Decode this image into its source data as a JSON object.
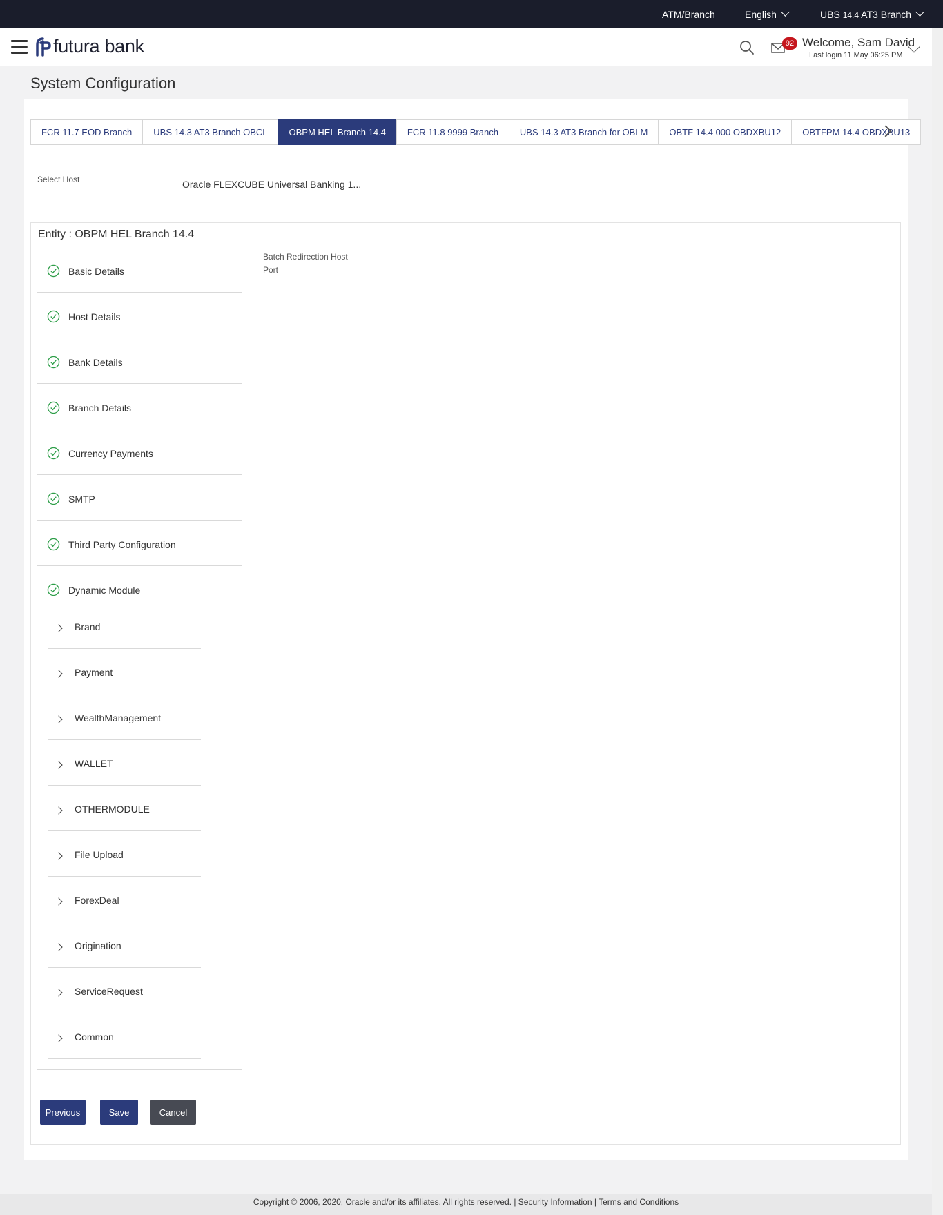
{
  "topbar": {
    "atm_branch": "ATM/Branch",
    "language": "English",
    "entity_prefix": "UBS",
    "entity_version": "14.4",
    "entity_suffix": "AT3 Branch"
  },
  "header": {
    "logo_text": "futura bank",
    "notification_count": "92",
    "welcome": "Welcome, Sam David",
    "last_login": "Last login 11 May 06:25 PM"
  },
  "page": {
    "title": "System Configuration"
  },
  "tabs": [
    {
      "label": "FCR 11.7 EOD Branch"
    },
    {
      "label": "UBS 14.3 AT3 Branch OBCL"
    },
    {
      "label": "OBPM HEL Branch 14.4"
    },
    {
      "label": "FCR 11.8 9999 Branch"
    },
    {
      "label": "UBS 14.3 AT3 Branch for OBLM"
    },
    {
      "label": "OBTF 14.4 000 OBDXBU12"
    },
    {
      "label": "OBTFPM 14.4 OBDXBU13"
    }
  ],
  "active_tab": "OBPM HEL Branch 14.4",
  "select_host": {
    "label": "Select Host",
    "value": "Oracle FLEXCUBE Universal Banking 1..."
  },
  "entity": {
    "title": "Entity : OBPM HEL Branch 14.4"
  },
  "steps": [
    {
      "label": "Basic Details"
    },
    {
      "label": "Host Details"
    },
    {
      "label": "Bank Details"
    },
    {
      "label": "Branch Details"
    },
    {
      "label": "Currency Payments"
    },
    {
      "label": "SMTP"
    },
    {
      "label": "Third Party Configuration"
    },
    {
      "label": "Dynamic Module"
    }
  ],
  "modules": [
    {
      "label": "Brand"
    },
    {
      "label": "Payment"
    },
    {
      "label": "WealthManagement"
    },
    {
      "label": "WALLET"
    },
    {
      "label": "OTHERMODULE"
    },
    {
      "label": "File Upload"
    },
    {
      "label": "ForexDeal"
    },
    {
      "label": "Origination"
    },
    {
      "label": "ServiceRequest"
    },
    {
      "label": "Common"
    }
  ],
  "field": {
    "label": "Batch Redirection Host Port"
  },
  "buttons": {
    "previous": "Previous",
    "save": "Save",
    "cancel": "Cancel"
  },
  "footer": {
    "text": "Copyright © 2006, 2020, Oracle and/or its affiliates. All rights reserved. | Security Information | Terms and Conditions"
  },
  "colors": {
    "primary": "#2b3b7b",
    "topbar": "#1a1d2b",
    "check_green": "#2e9e49",
    "badge_red": "#c5161d",
    "cancel_gray": "#474a53"
  }
}
